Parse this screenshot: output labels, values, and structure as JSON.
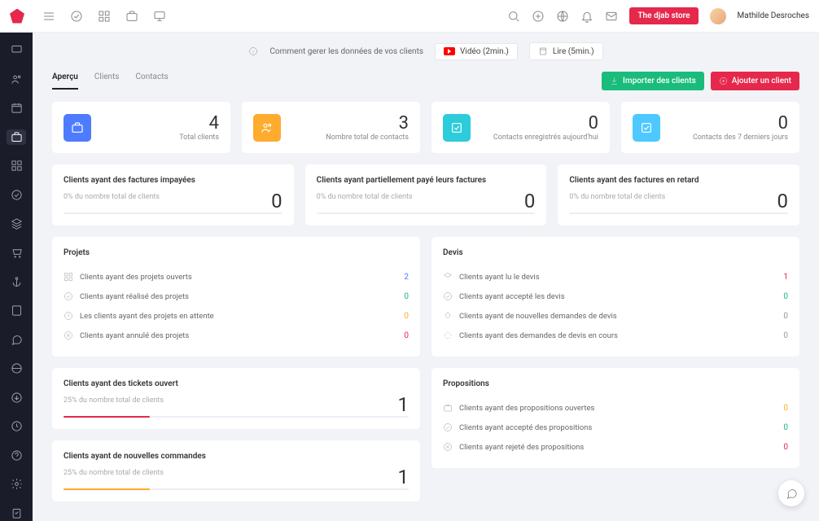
{
  "topbar": {
    "store_btn": "The djab store",
    "username": "Mathilde Desroches"
  },
  "info": {
    "text": "Comment gerer les données de vos clients",
    "video": "Vidéo (2min.)",
    "read": "Lire (5min.)"
  },
  "tabs": {
    "apercu": "Aperçu",
    "clients": "Clients",
    "contacts": "Contacts"
  },
  "actions": {
    "import": "Importer des clients",
    "add": "Ajouter un client"
  },
  "stats": [
    {
      "value": "4",
      "label": "Total clients"
    },
    {
      "value": "3",
      "label": "Nombre total de contacts"
    },
    {
      "value": "0",
      "label": "Contacts enregistrés aujourd'hui"
    },
    {
      "value": "0",
      "label": "Contacts des 7 derniers jours"
    }
  ],
  "mid": [
    {
      "title": "Clients ayant des factures impayées",
      "sub": "0% du nombre total de clients",
      "value": "0"
    },
    {
      "title": "Clients ayant partiellement payé leurs factures",
      "sub": "0% du nombre total de clients",
      "value": "0"
    },
    {
      "title": "Clients ayant des factures en retard",
      "sub": "0% du nombre total de clients",
      "value": "0"
    }
  ],
  "projects": {
    "title": "Projets",
    "rows": [
      {
        "label": "Clients ayant des projets ouverts",
        "value": "2"
      },
      {
        "label": "Clients ayant réalisé des projets",
        "value": "0"
      },
      {
        "label": "Les clients ayant des projets en attente",
        "value": "0"
      },
      {
        "label": "Clients ayant annulé des projets",
        "value": "0"
      }
    ]
  },
  "devis": {
    "title": "Devis",
    "rows": [
      {
        "label": "Clients ayant lu le devis",
        "value": "1"
      },
      {
        "label": "Clients ayant accepté les devis",
        "value": "0"
      },
      {
        "label": "Clients ayant de nouvelles demandes de devis",
        "value": "0"
      },
      {
        "label": "Clients ayant des demandes de devis en cours",
        "value": "0"
      }
    ]
  },
  "tickets": {
    "title": "Clients ayant des tickets ouvert",
    "sub": "25% du nombre total de clients",
    "value": "1"
  },
  "orders": {
    "title": "Clients ayant de nouvelles commandes",
    "sub": "25% du nombre total de clients",
    "value": "1"
  },
  "props": {
    "title": "Propositions",
    "rows": [
      {
        "label": "Clients ayant des propositions ouvertes",
        "value": "0"
      },
      {
        "label": "Clients ayant accepté des propositions",
        "value": "0"
      },
      {
        "label": "Clients ayant rejeté des propositions",
        "value": "0"
      }
    ]
  }
}
